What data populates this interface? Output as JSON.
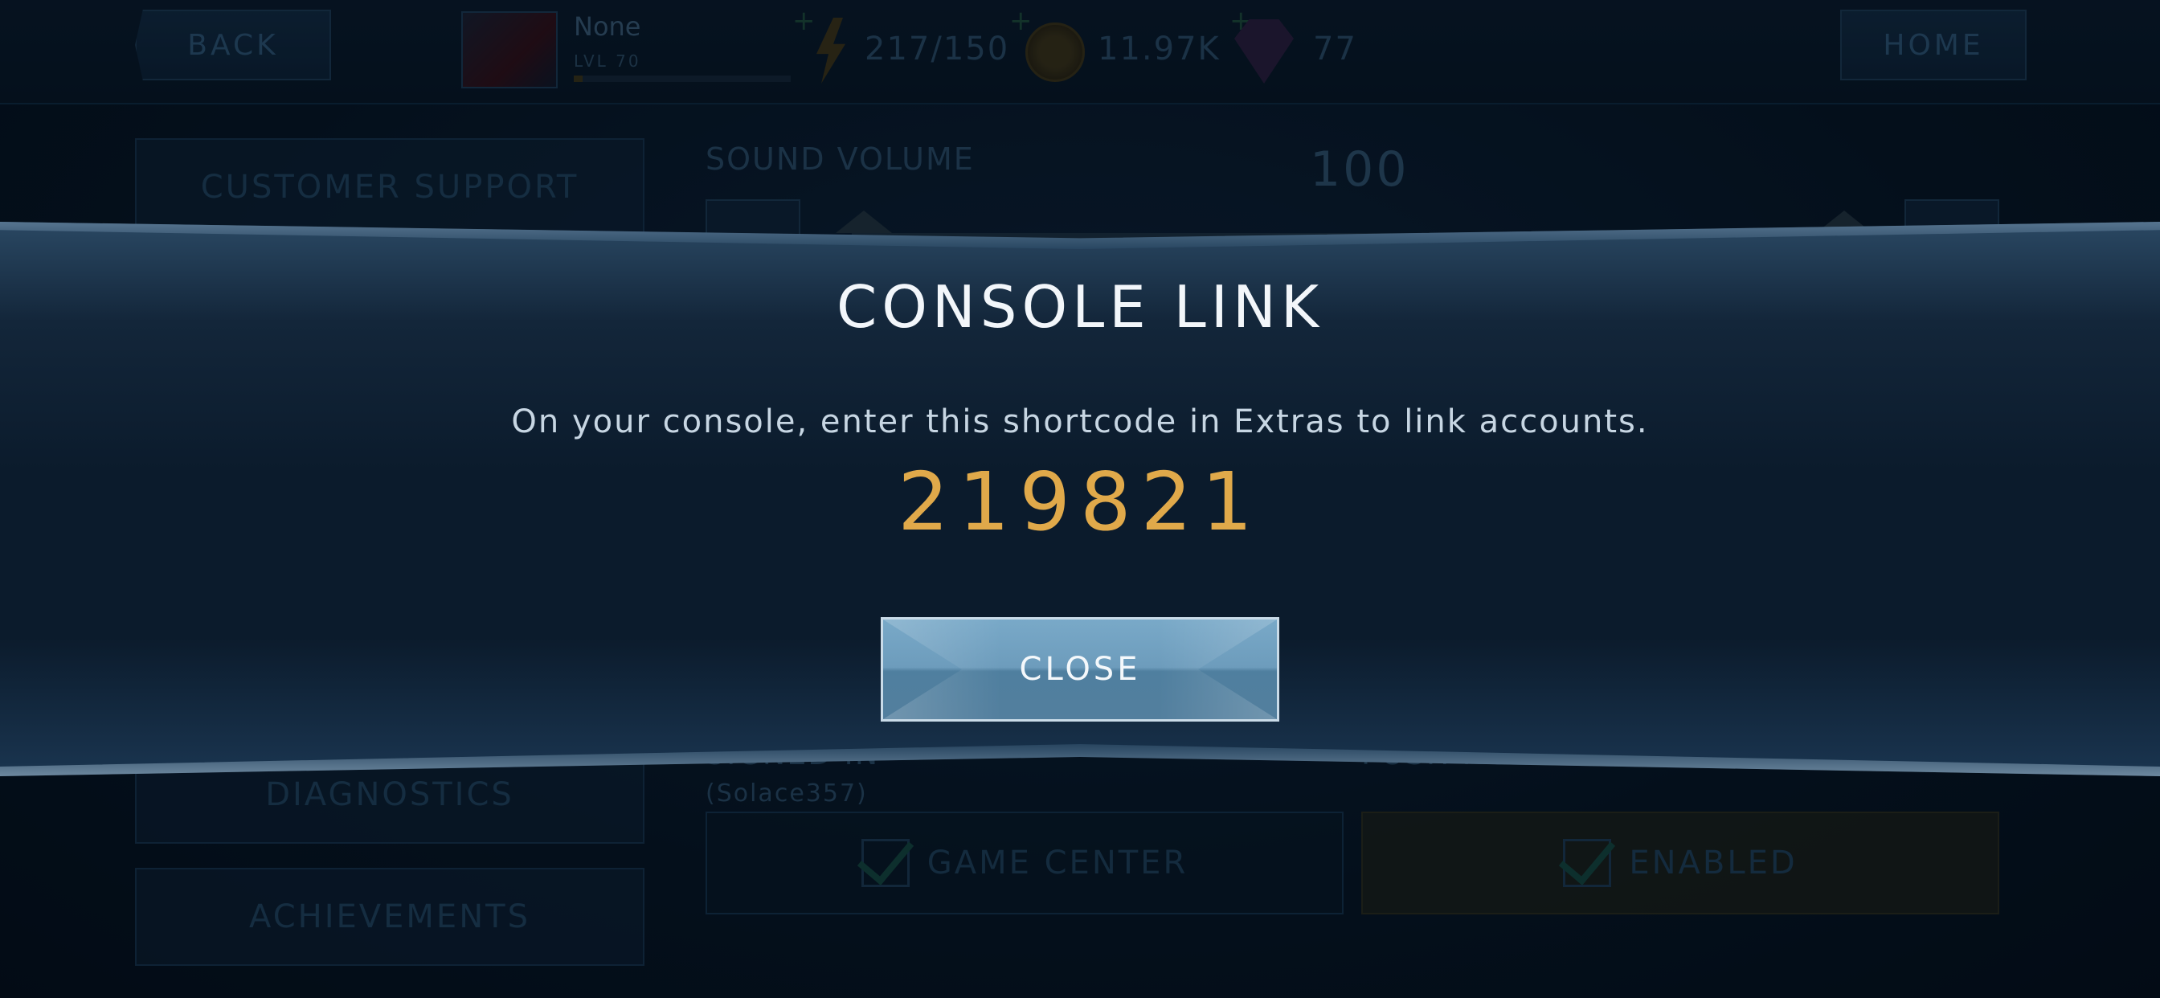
{
  "topbar": {
    "back_label": "BACK",
    "home_label": "HOME",
    "player_name": "None",
    "player_level": "LVL 70",
    "xp_progress": 0.04,
    "energy": "217/150",
    "coins": "11.97K",
    "gems": "77"
  },
  "menu": {
    "customer_support": "CUSTOMER SUPPORT",
    "diagnostics": "DIAGNOSTICS",
    "achievements": "ACHIEVEMENTS"
  },
  "settings": {
    "sound_volume_label": "SOUND VOLUME",
    "sound_volume_value": "100",
    "signed_in_label": "SIGNED IN",
    "signed_in_user": "(Solace357)",
    "game_center_label": "GAME CENTER",
    "push_notifications_label": "PUSH NOTIFICATIONS",
    "push_enabled_label": "ENABLED"
  },
  "dialog": {
    "title": "CONSOLE LINK",
    "message": "On your console, enter this shortcode in Extras to link accounts.",
    "code": "219821",
    "close_label": "CLOSE"
  },
  "colors": {
    "code": "#e0a94a",
    "close_button": "#6d9cbc",
    "background": "#071523"
  }
}
